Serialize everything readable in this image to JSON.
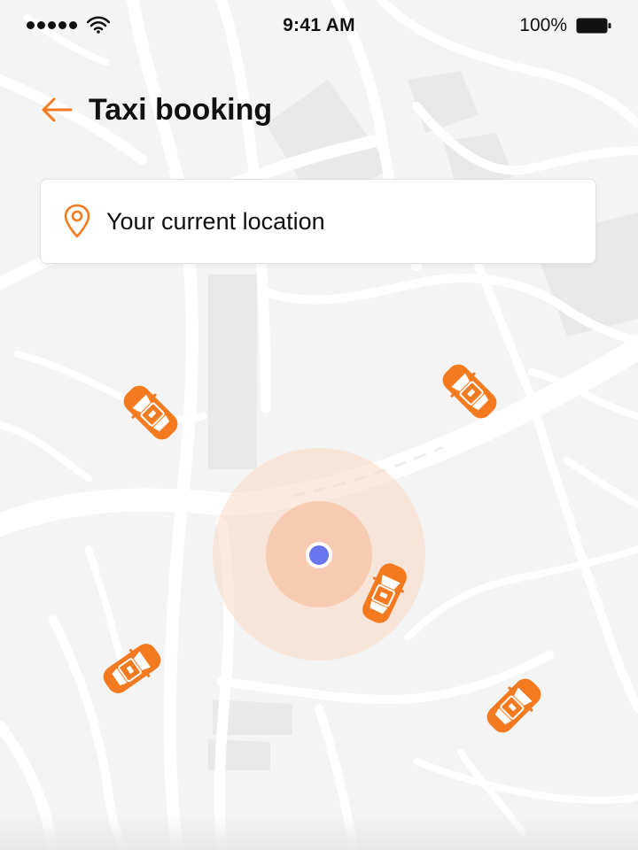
{
  "status_bar": {
    "time": "9:41 AM",
    "battery_percent": "100%",
    "signal_icon": "signal-dots-icon",
    "wifi_icon": "wifi-icon",
    "battery_icon": "battery-full-icon"
  },
  "header": {
    "back_icon": "arrow-left-icon",
    "title": "Taxi booking"
  },
  "location": {
    "icon": "map-pin-icon",
    "label": "Your current location"
  },
  "map": {
    "user_marker_icon": "current-location-dot-icon",
    "taxi_icon": "taxi-car-icon",
    "taxi_count": 5
  },
  "colors": {
    "accent": "#F47A20",
    "user_dot": "#6A75F0",
    "map_bg": "#F4F4F4",
    "roads": "#FFFFFF",
    "blocks": "#E9E9E9",
    "pulse": "#F9CBB0"
  }
}
